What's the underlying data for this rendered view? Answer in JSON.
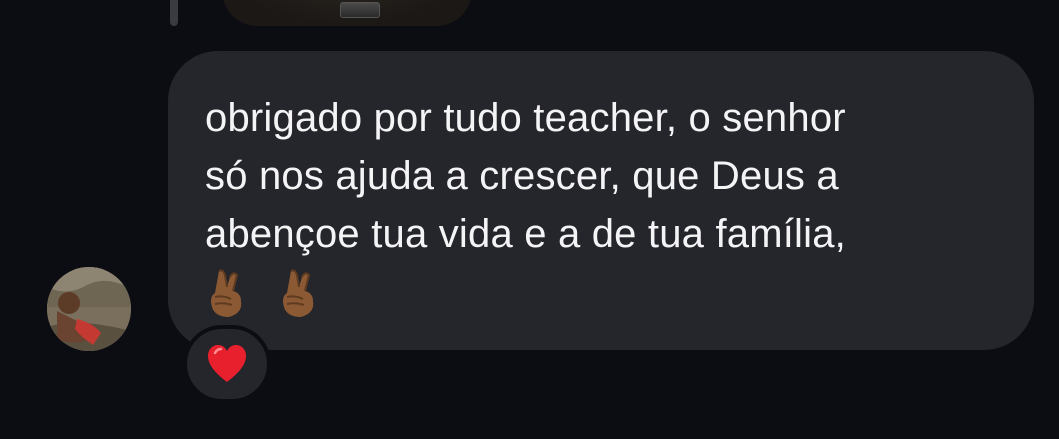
{
  "conversation": {
    "previous_message": {
      "type": "media"
    },
    "message": {
      "direction": "incoming",
      "lines": [
        "obrigado por tudo teacher, o senhor",
        "só nos ajuda a crescer, que Deus a",
        "abençoe tua vida e a de tua família,"
      ],
      "emojis": [
        "crossed-fingers-medium-dark-skin",
        "crossed-fingers-medium-dark-skin"
      ],
      "bubble_color": "#25262b",
      "text_color": "#f4f4f6"
    },
    "reaction": {
      "emoji": "red-heart",
      "color": "#e8202e"
    },
    "sender_avatar": {
      "icon": "user-avatar-photo"
    }
  },
  "theme": {
    "background": "#0c0d12"
  }
}
